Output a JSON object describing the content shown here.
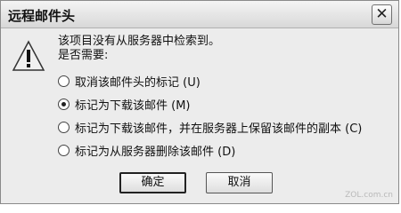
{
  "window": {
    "title": "远程邮件头",
    "close_glyph": "✕"
  },
  "message": {
    "line1": "该项目没有从服务器中检索到。",
    "line2": "是否需要:"
  },
  "options": [
    {
      "label": "取消该邮件头的标记 (U)",
      "checked": false
    },
    {
      "label": "标记为下载该邮件 (M)",
      "checked": true
    },
    {
      "label": "标记为下载该邮件，并在服务器上保留该邮件的副本 (C)",
      "checked": false
    },
    {
      "label": "标记为从服务器删除该邮件 (D)",
      "checked": false
    }
  ],
  "buttons": {
    "ok": "确定",
    "cancel": "取消"
  },
  "watermark": "ZOL.com.cn"
}
